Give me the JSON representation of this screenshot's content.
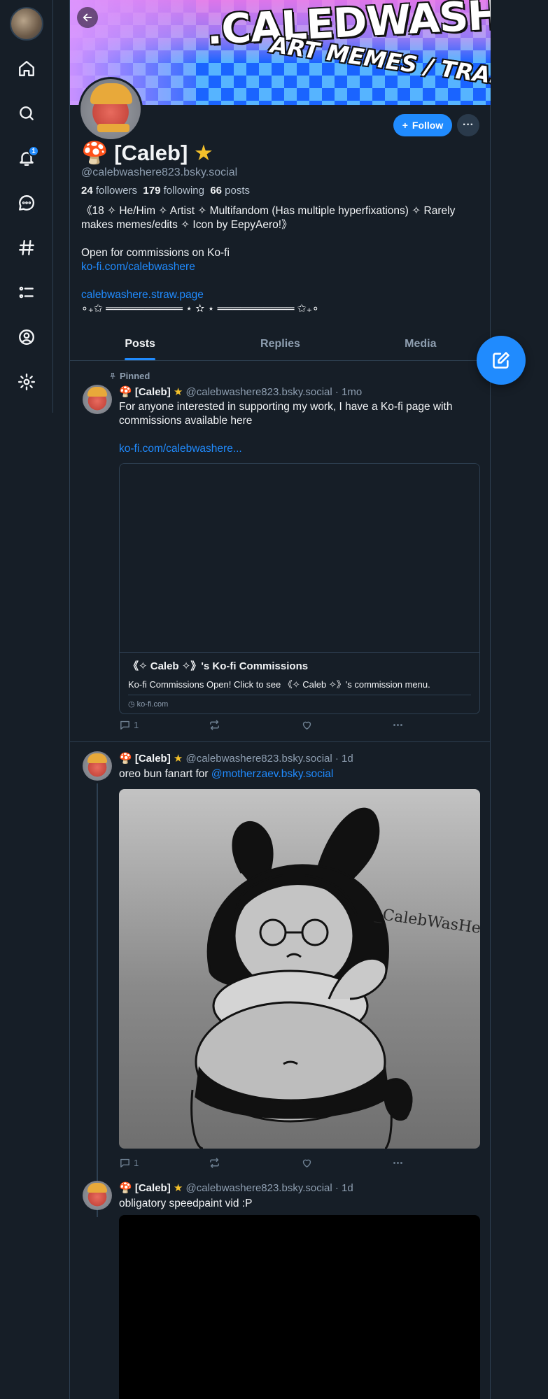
{
  "nav": {
    "items": [
      {
        "name": "home-icon"
      },
      {
        "name": "search-icon"
      },
      {
        "name": "notifications-icon",
        "badge": "1"
      },
      {
        "name": "chat-icon"
      },
      {
        "name": "hashtag-icon"
      },
      {
        "name": "lists-icon"
      },
      {
        "name": "profile-icon"
      },
      {
        "name": "settings-icon"
      }
    ]
  },
  "banner": {
    "text_main": ".CALEDWASHERE_",
    "text_sub": "ART MEMES / TRASH"
  },
  "profile": {
    "mushroom": "🍄",
    "display_name": "[Caleb]",
    "star": "★",
    "handle": "@calebwashere823.bsky.social",
    "followers_count": "24",
    "followers_label": "followers",
    "following_count": "179",
    "following_label": "following",
    "posts_count": "66",
    "posts_label": "posts",
    "follow_label": "Follow",
    "more_label": "···",
    "bio": {
      "line1": "《18 ✧ He/Him ✧ Artist ✧ Multifandom (Has multiple hyperfixations) ✧ Rarely makes memes/edits ✧ Icon by EepyAero!》",
      "line2": "Open for commissions on Ko-fi",
      "link1": "ko-fi.com/calebwashere",
      "link2": "calebwashere.straw.page",
      "line3": "∘₊✩ ══════════ ⋆ ✫ ⋆ ══════════ ✩₊∘"
    }
  },
  "tabs": [
    {
      "label": "Posts",
      "active": true
    },
    {
      "label": "Replies",
      "active": false
    },
    {
      "label": "Media",
      "active": false
    }
  ],
  "posts": [
    {
      "pinned_label": "Pinned",
      "name": "[Caleb]",
      "meta": "@calebwashere823.bsky.social · 1mo",
      "text": "For anyone interested in supporting my work, I have a Ko-fi page with commissions available here",
      "link": "ko-fi.com/calebwashere...",
      "embed_title": "《✧ Caleb ✧》's Ko-fi Commissions",
      "embed_desc": "Ko-fi Commissions Open! Click to see 《✧ Caleb ✧》's commission menu.",
      "embed_domain": "ko-fi.com",
      "reply_count": "1"
    },
    {
      "name": "[Caleb]",
      "meta": "@calebwashere823.bsky.social · 1d",
      "text": "oreo bun fanart for ",
      "mention": "@motherzaev.bsky.social",
      "image_signature": "_CalebWasHere_",
      "reply_count": "1"
    },
    {
      "name": "[Caleb]",
      "meta": "@calebwashere823.bsky.social · 1d",
      "text": "obligatory speedpaint vid :P"
    }
  ],
  "colors": {
    "background": "#161e27",
    "accent": "#208bfe",
    "star": "#f3c02b",
    "muted_text": "#8e9eb0",
    "border": "#2e4052"
  }
}
